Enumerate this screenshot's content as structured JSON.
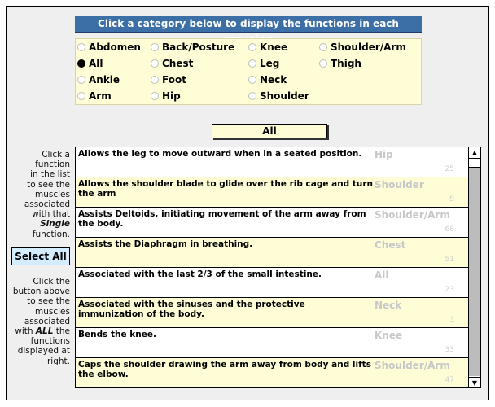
{
  "header": {
    "title": "Click a category below to display the functions in each grouping"
  },
  "categories": [
    {
      "label": "Abdomen",
      "selected": false
    },
    {
      "label": "All",
      "selected": true
    },
    {
      "label": "Ankle",
      "selected": false
    },
    {
      "label": "Arm",
      "selected": false
    },
    {
      "label": "Back/Posture",
      "selected": false
    },
    {
      "label": "Chest",
      "selected": false
    },
    {
      "label": "Foot",
      "selected": false
    },
    {
      "label": "Hip",
      "selected": false
    },
    {
      "label": "Knee",
      "selected": false
    },
    {
      "label": "Leg",
      "selected": false
    },
    {
      "label": "Neck",
      "selected": false
    },
    {
      "label": "Shoulder",
      "selected": false
    },
    {
      "label": "Shoulder/Arm",
      "selected": false
    },
    {
      "label": "Thigh",
      "selected": false
    }
  ],
  "current_category": "All",
  "sidebar": {
    "help_single": [
      "Click a",
      "function",
      "in the list",
      "to see the",
      "muscles",
      "associated",
      "with that",
      "Single",
      "function."
    ],
    "select_all_label": "Select All",
    "help_all": [
      "Click the",
      "button above",
      "to see the",
      "muscles",
      "associated",
      "with ALL the",
      "functions",
      "displayed at",
      "right."
    ]
  },
  "functions": [
    {
      "description": "Allows the leg to move outward when in a seated position.",
      "category": "Hip",
      "count": "25"
    },
    {
      "description": "Allows the shoulder blade to glide over the rib cage and turn the arm",
      "category": "Shoulder",
      "count": "9"
    },
    {
      "description": "Assists Deltoids, initiating movement of the arm away from the body.",
      "category": "Shoulder/Arm",
      "count": "68"
    },
    {
      "description": "Assists the Diaphragm in breathing.",
      "category": "Chest",
      "count": "51"
    },
    {
      "description": "Associated with the last 2/3 of the small intestine.",
      "category": "All",
      "count": "23"
    },
    {
      "description": "Associated with the sinuses and the protective immunization of the body.",
      "category": "Neck",
      "count": "3"
    },
    {
      "description": "Bends the knee.",
      "category": "Knee",
      "count": "33"
    },
    {
      "description": "Caps the shoulder drawing the arm away from body and lifts the elbow.",
      "category": "Shoulder/Arm",
      "count": "47"
    }
  ],
  "scrollbar": {
    "up_glyph": "▲",
    "down_glyph": "▼",
    "position": 0
  }
}
